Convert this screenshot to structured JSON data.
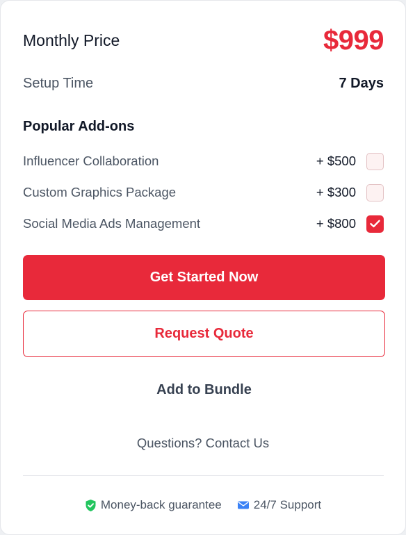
{
  "pricing": {
    "monthly_label": "Monthly Price",
    "monthly_value": "$999",
    "setup_label": "Setup Time",
    "setup_value": "7 Days"
  },
  "addons": {
    "title": "Popular Add-ons",
    "items": [
      {
        "name": "Influencer Collaboration",
        "price": "+ $500",
        "checked": false
      },
      {
        "name": "Custom Graphics Package",
        "price": "+ $300",
        "checked": false
      },
      {
        "name": "Social Media Ads Management",
        "price": "+ $800",
        "checked": true
      }
    ]
  },
  "actions": {
    "primary_label": "Get Started Now",
    "secondary_label": "Request Quote",
    "tertiary_label": "Add to Bundle",
    "contact_label": "Questions? Contact Us"
  },
  "footer": {
    "guarantee_label": "Money-back guarantee",
    "guarantee_icon": "shield-check-icon",
    "support_label": "24/7 Support",
    "support_icon": "envelope-icon"
  },
  "colors": {
    "accent": "#e8293a",
    "guarantee_icon": "#22c55e",
    "support_icon": "#3b82f6"
  }
}
